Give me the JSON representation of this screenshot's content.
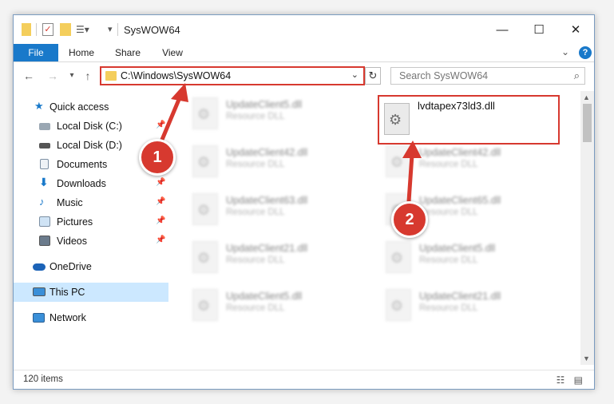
{
  "window": {
    "title": "SysWOW64",
    "controls": {
      "minimize": "—",
      "maximize": "☐",
      "close": "✕"
    }
  },
  "ribbon": {
    "tabs": [
      "File",
      "Home",
      "Share",
      "View"
    ],
    "expand_icon": "chevron-down-icon",
    "help_label": "?"
  },
  "navigation": {
    "back": "←",
    "forward": "→",
    "recent": "▾",
    "up": "↑",
    "address_path": "C:\\Windows\\SysWOW64",
    "address_chevron": "⌄",
    "refresh": "↻",
    "search_placeholder": "Search SysWOW64",
    "search_icon": "⌕"
  },
  "sidebar": {
    "items": [
      {
        "label": "Quick access",
        "icon": "star-icon",
        "pinned": false
      },
      {
        "label": "Local Disk (C:)",
        "icon": "drive-icon",
        "pinned": true
      },
      {
        "label": "Local Disk (D:)",
        "icon": "drive-icon",
        "pinned": true
      },
      {
        "label": "Documents",
        "icon": "documents-icon",
        "pinned": true
      },
      {
        "label": "Downloads",
        "icon": "download-icon",
        "pinned": true
      },
      {
        "label": "Music",
        "icon": "music-icon",
        "pinned": true
      },
      {
        "label": "Pictures",
        "icon": "pictures-icon",
        "pinned": true
      },
      {
        "label": "Videos",
        "icon": "videos-icon",
        "pinned": true
      },
      {
        "label": "OneDrive",
        "icon": "cloud-icon",
        "pinned": false
      },
      {
        "label": "This PC",
        "icon": "computer-icon",
        "pinned": false,
        "selected": true
      },
      {
        "label": "Network",
        "icon": "network-icon",
        "pinned": false
      }
    ],
    "pin_glyph": "📌"
  },
  "files": [
    {
      "name": "UpdateClient5.dll",
      "type": "Resource DLL"
    },
    {
      "name": "lvdtapex73ld3.dll",
      "type": "",
      "highlighted": true
    },
    {
      "name": "UpdateClient42.dll",
      "type": "Resource DLL"
    },
    {
      "name": "UpdateClient42.dll",
      "type": "Resource DLL"
    },
    {
      "name": "UpdateClient63.dll",
      "type": "Resource DLL"
    },
    {
      "name": "UpdateClient65.dll",
      "type": "Resource DLL"
    },
    {
      "name": "UpdateClient21.dll",
      "type": "Resource DLL"
    },
    {
      "name": "UpdateClient5.dll",
      "type": "Resource DLL"
    },
    {
      "name": "UpdateClient5.dll",
      "type": "Resource DLL"
    },
    {
      "name": "UpdateClient21.dll",
      "type": "Resource DLL"
    }
  ],
  "status": {
    "item_count": "120 items",
    "view_icons": "☷ ▤"
  },
  "annotations": {
    "step1": "1",
    "step2": "2",
    "color": "#d7392f"
  },
  "scrollbar": {
    "up": "▲",
    "down": "▼"
  }
}
